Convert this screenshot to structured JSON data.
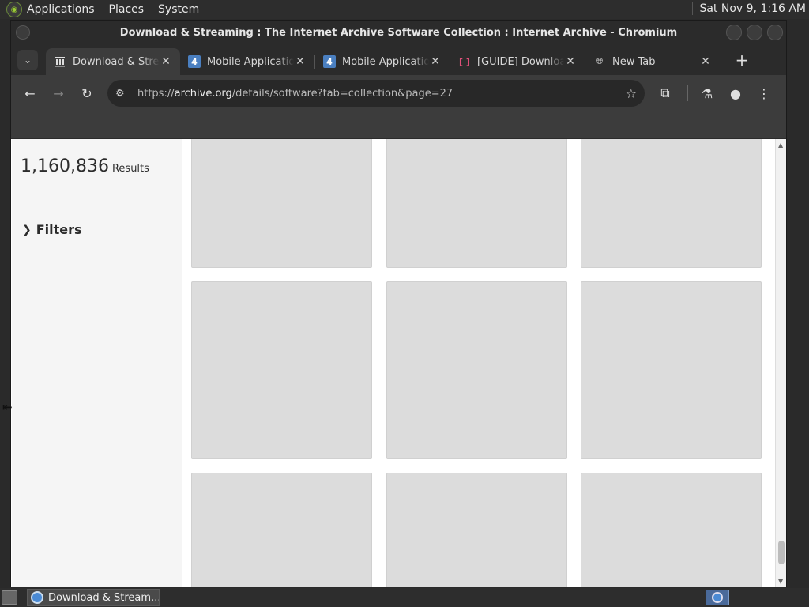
{
  "top_panel": {
    "menus": [
      "Applications",
      "Places",
      "System"
    ],
    "clock": "Sat Nov 9, 1:16 AM"
  },
  "window": {
    "title": "Download & Streaming : The Internet Archive Software Collection : Internet Archive - Chromium"
  },
  "tabs": [
    {
      "label": "Download & Streaming",
      "icon": "archive-icon",
      "active": true
    },
    {
      "label": "Mobile Applications",
      "icon": "four-icon",
      "active": false
    },
    {
      "label": "Mobile Applications",
      "icon": "four-icon",
      "active": false
    },
    {
      "label": "[GUIDE] Download",
      "icon": "bracket-icon",
      "active": false
    },
    {
      "label": "New Tab",
      "icon": "globe-icon",
      "active": false
    }
  ],
  "toolbar": {
    "url_scheme": "https://",
    "url_host": "archive.org",
    "url_path": "/details/software?tab=collection&page=27"
  },
  "content": {
    "results_count": "1,160,836",
    "results_word": "Results",
    "filters_label": "Filters"
  },
  "taskbar": {
    "task_label": "Download & Stream..."
  }
}
